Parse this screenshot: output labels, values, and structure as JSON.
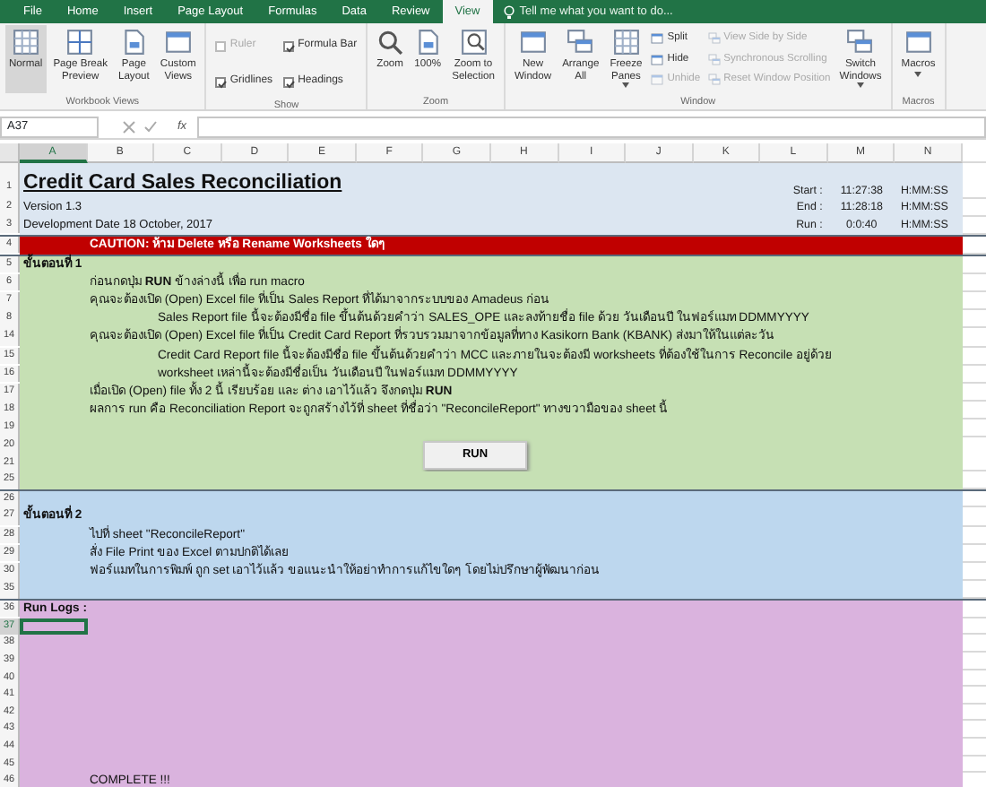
{
  "ribbon": {
    "tabs": [
      {
        "label": "File",
        "selected": false
      },
      {
        "label": "Home",
        "selected": false
      },
      {
        "label": "Insert",
        "selected": false
      },
      {
        "label": "Page Layout",
        "selected": false
      },
      {
        "label": "Formulas",
        "selected": false
      },
      {
        "label": "Data",
        "selected": false
      },
      {
        "label": "Review",
        "selected": false
      },
      {
        "label": "View",
        "selected": true
      }
    ],
    "tell_me": {
      "placeholder": "Tell me what you want to do..."
    },
    "groups": [
      {
        "label": "Workbook Views",
        "items": [
          {
            "kind": "large",
            "lines": [
              "Normal"
            ],
            "selected": true
          },
          {
            "kind": "large",
            "lines": [
              "Page Break",
              "Preview"
            ],
            "selected": false
          },
          {
            "kind": "large",
            "lines": [
              "Page",
              "Layout"
            ],
            "selected": false
          },
          {
            "kind": "large",
            "lines": [
              "Custom",
              "Views"
            ],
            "selected": false
          }
        ]
      },
      {
        "label": "Show",
        "items": [
          {
            "kind": "stack",
            "items": [
              {
                "kind": "check",
                "label": "Ruler",
                "checked": false,
                "disabled": true
              },
              {
                "kind": "check",
                "label": "Gridlines",
                "checked": true,
                "disabled": false
              }
            ]
          },
          {
            "kind": "stack",
            "items": [
              {
                "kind": "check",
                "label": "Formula Bar",
                "checked": true,
                "disabled": false
              },
              {
                "kind": "check",
                "label": "Headings",
                "checked": true,
                "disabled": false
              }
            ]
          }
        ]
      },
      {
        "label": "Zoom",
        "items": [
          {
            "kind": "large",
            "lines": [
              "Zoom"
            ]
          },
          {
            "kind": "large",
            "lines": [
              "100%"
            ]
          },
          {
            "kind": "large",
            "lines": [
              "Zoom to",
              "Selection"
            ]
          }
        ]
      },
      {
        "label": "Window",
        "items": [
          {
            "kind": "large",
            "lines": [
              "New",
              "Window"
            ]
          },
          {
            "kind": "large",
            "lines": [
              "Arrange",
              "All"
            ]
          },
          {
            "kind": "large",
            "lines": [
              "Freeze",
              "Panes"
            ],
            "dropdown": true
          },
          {
            "kind": "stack",
            "items": [
              {
                "kind": "small",
                "label": "Split",
                "disabled": false
              },
              {
                "kind": "small",
                "label": "Hide",
                "disabled": false
              },
              {
                "kind": "small",
                "label": "Unhide",
                "disabled": true
              }
            ]
          },
          {
            "kind": "stack",
            "items": [
              {
                "kind": "small",
                "label": "View Side by Side",
                "disabled": true
              },
              {
                "kind": "small",
                "label": "Synchronous Scrolling",
                "disabled": true
              },
              {
                "kind": "small",
                "label": "Reset Window Position",
                "disabled": true
              }
            ]
          },
          {
            "kind": "large",
            "lines": [
              "Switch",
              "Windows"
            ],
            "dropdown": true
          }
        ]
      },
      {
        "label": "Macros",
        "items": [
          {
            "kind": "large",
            "lines": [
              "Macros"
            ],
            "dropdown": true
          }
        ]
      }
    ]
  },
  "formula_bar": {
    "name_box": "A37",
    "function_label": "fx"
  },
  "sheet": {
    "columns": [
      {
        "label": "A",
        "selected": true
      },
      {
        "label": "B",
        "selected": false
      },
      {
        "label": "C",
        "selected": false
      },
      {
        "label": "D",
        "selected": false
      },
      {
        "label": "E",
        "selected": false
      },
      {
        "label": "F",
        "selected": false
      },
      {
        "label": "G",
        "selected": false
      },
      {
        "label": "H",
        "selected": false
      },
      {
        "label": "I",
        "selected": false
      },
      {
        "label": "J",
        "selected": false
      },
      {
        "label": "K",
        "selected": false
      },
      {
        "label": "L",
        "selected": false
      },
      {
        "label": "M",
        "selected": false
      },
      {
        "label": "N",
        "selected": false
      }
    ],
    "sections": [
      {
        "color": "#dce6f1",
        "rows": [
          {
            "kind": "title",
            "numbers": [
              "1"
            ],
            "text": "Credit Card Sales Reconciliation",
            "time": {
              "label": "Start :",
              "value": "11:27:38",
              "format": "H:MM:SS"
            }
          },
          {
            "kind": "info",
            "numbers": [
              "2"
            ],
            "text": "Version 1.3",
            "time": {
              "label": "End :",
              "value": "11:28:18",
              "format": "H:MM:SS"
            }
          },
          {
            "kind": "info",
            "numbers": [
              "3"
            ],
            "text": "Development Date 18 October, 2017",
            "time": {
              "label": "Run :",
              "value": "0:0:40",
              "format": "H:MM:SS"
            }
          }
        ]
      },
      {
        "color": "#c00000",
        "rows": [
          {
            "kind": "caution",
            "numbers": [
              "4"
            ],
            "text": "CAUTION: ห้าม Delete หรือ Rename Worksheets ใดๆ"
          }
        ]
      },
      {
        "color": "#c6e0b4",
        "rows": [
          {
            "kind": "heading",
            "numbers": [
              "5"
            ],
            "text": "ขั้นตอนที่ 1"
          },
          {
            "kind": "step",
            "numbers": [
              "6"
            ],
            "text": "ก่อนกดปุ่ม **RUN** ข้างล่างนี้ เพื่อ run macro"
          },
          {
            "kind": "step",
            "numbers": [
              "7"
            ],
            "text": "คุณจะต้องเปิด (Open) Excel file ที่เป็น Sales Report ที่ได้มาจากระบบของ Amadeus ก่อน"
          },
          {
            "kind": "substep",
            "numbers": [
              "8"
            ],
            "text": "Sales Report file นี้จะต้องมีชื่อ file ขึ้นต้นด้วยคำว่า SALES_OPE และลงท้ายชื่อ file ด้วย วันเดือนปี ในฟอร์แมท DDMMYYYY"
          },
          {
            "kind": "step",
            "numbers": [
              "14"
            ],
            "text": "คุณจะต้องเปิด (Open) Excel file ที่เป็น Credit Card Report ที่รวบรวมมาจากข้อมูลที่ทาง Kasikorn Bank (KBANK) ส่งมาให้ในแต่ละวัน"
          },
          {
            "kind": "substep",
            "numbers": [
              "15"
            ],
            "text": "Credit Card Report file นี้จะต้องมีชื่อ file ขึ้นต้นด้วยคำว่า MCC และภายในจะต้องมี worksheets ที่ต้องใช้ในการ Reconcile อยู่ด้วย"
          },
          {
            "kind": "substep",
            "numbers": [
              "16"
            ],
            "text": "worksheet เหล่านี้จะต้องมีชื่อเป็น วันเดือนปี ในฟอร์แมท DDMMYYYY"
          },
          {
            "kind": "step",
            "numbers": [
              "17"
            ],
            "text": "เมื่อเปิด (Open) file ทั้ง 2 นี้ เรียบร้อย และ ต่าง เอาไว้แล้ว จึงกดปุ่ม **RUN**"
          },
          {
            "kind": "step",
            "numbers": [
              "18"
            ],
            "text": "ผลการ run คือ Reconciliation Report จะถูกสร้างไว้ที่ sheet ที่ชื่อว่า \"ReconcileReport\" ทางขวามือของ sheet นี้"
          },
          {
            "kind": "blank",
            "numbers": [
              "19"
            ]
          },
          {
            "kind": "button",
            "numbers": [
              "20",
              "21"
            ],
            "text": "RUN"
          },
          {
            "kind": "blank",
            "numbers": [
              "25"
            ]
          }
        ]
      },
      {
        "color": "#bdd7ee",
        "rows": [
          {
            "kind": "blank",
            "numbers": [
              "26"
            ]
          },
          {
            "kind": "heading",
            "numbers": [
              "27"
            ],
            "text": "ขั้นตอนที่ 2"
          },
          {
            "kind": "step",
            "numbers": [
              "28"
            ],
            "text": "ไปที่ sheet \"ReconcileReport\""
          },
          {
            "kind": "step",
            "numbers": [
              "29"
            ],
            "text": "สั่ง File Print ของ Excel ตามปกติได้เลย"
          },
          {
            "kind": "step",
            "numbers": [
              "30"
            ],
            "text": "ฟอร์แมทในการพิมพ์ ถูก set เอาไว้แล้ว ขอแนะนำให้อย่าทำการแก้ไขใดๆ โดยไม่ปรึกษาผู้พัฒนาก่อน"
          },
          {
            "kind": "blank",
            "numbers": [
              "35"
            ]
          }
        ]
      },
      {
        "color": "#dab3de",
        "rows": [
          {
            "kind": "heading",
            "numbers": [
              "36"
            ],
            "text": "Run Logs :"
          },
          {
            "kind": "active",
            "numbers": [
              "37"
            ]
          },
          {
            "kind": "blank",
            "numbers": [
              "38"
            ]
          },
          {
            "kind": "blank",
            "numbers": [
              "39"
            ]
          },
          {
            "kind": "blank",
            "numbers": [
              "40"
            ]
          },
          {
            "kind": "blank",
            "numbers": [
              "41"
            ]
          },
          {
            "kind": "blank",
            "numbers": [
              "42"
            ]
          },
          {
            "kind": "blank",
            "numbers": [
              "43"
            ]
          },
          {
            "kind": "blank",
            "numbers": [
              "44"
            ]
          },
          {
            "kind": "blank",
            "numbers": [
              "45"
            ]
          },
          {
            "kind": "log",
            "numbers": [
              "46"
            ],
            "text": "COMPLETE !!!"
          }
        ]
      }
    ]
  }
}
